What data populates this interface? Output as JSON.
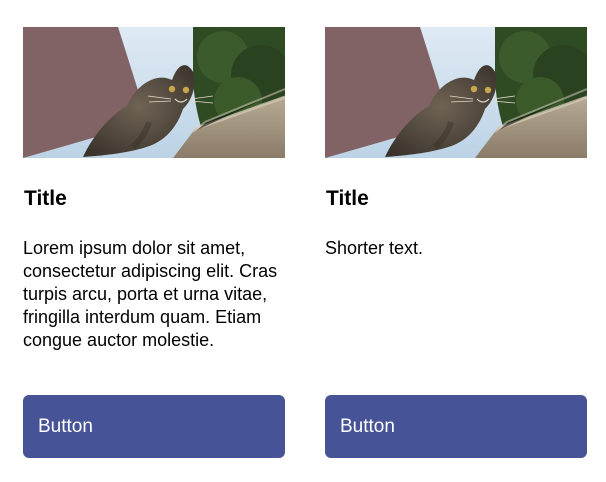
{
  "cards": [
    {
      "title": "Title",
      "text": "Lorem ipsum dolor sit amet, consectetur adipiscing elit. Cras turpis arcu, porta et urna vitae, fringilla interdum quam. Etiam congue auctor molestie.",
      "button_label": "Button"
    },
    {
      "title": "Title",
      "text": "Shorter text.",
      "button_label": "Button"
    }
  ],
  "colors": {
    "button_bg": "#465396",
    "button_text": "#ffffff"
  }
}
